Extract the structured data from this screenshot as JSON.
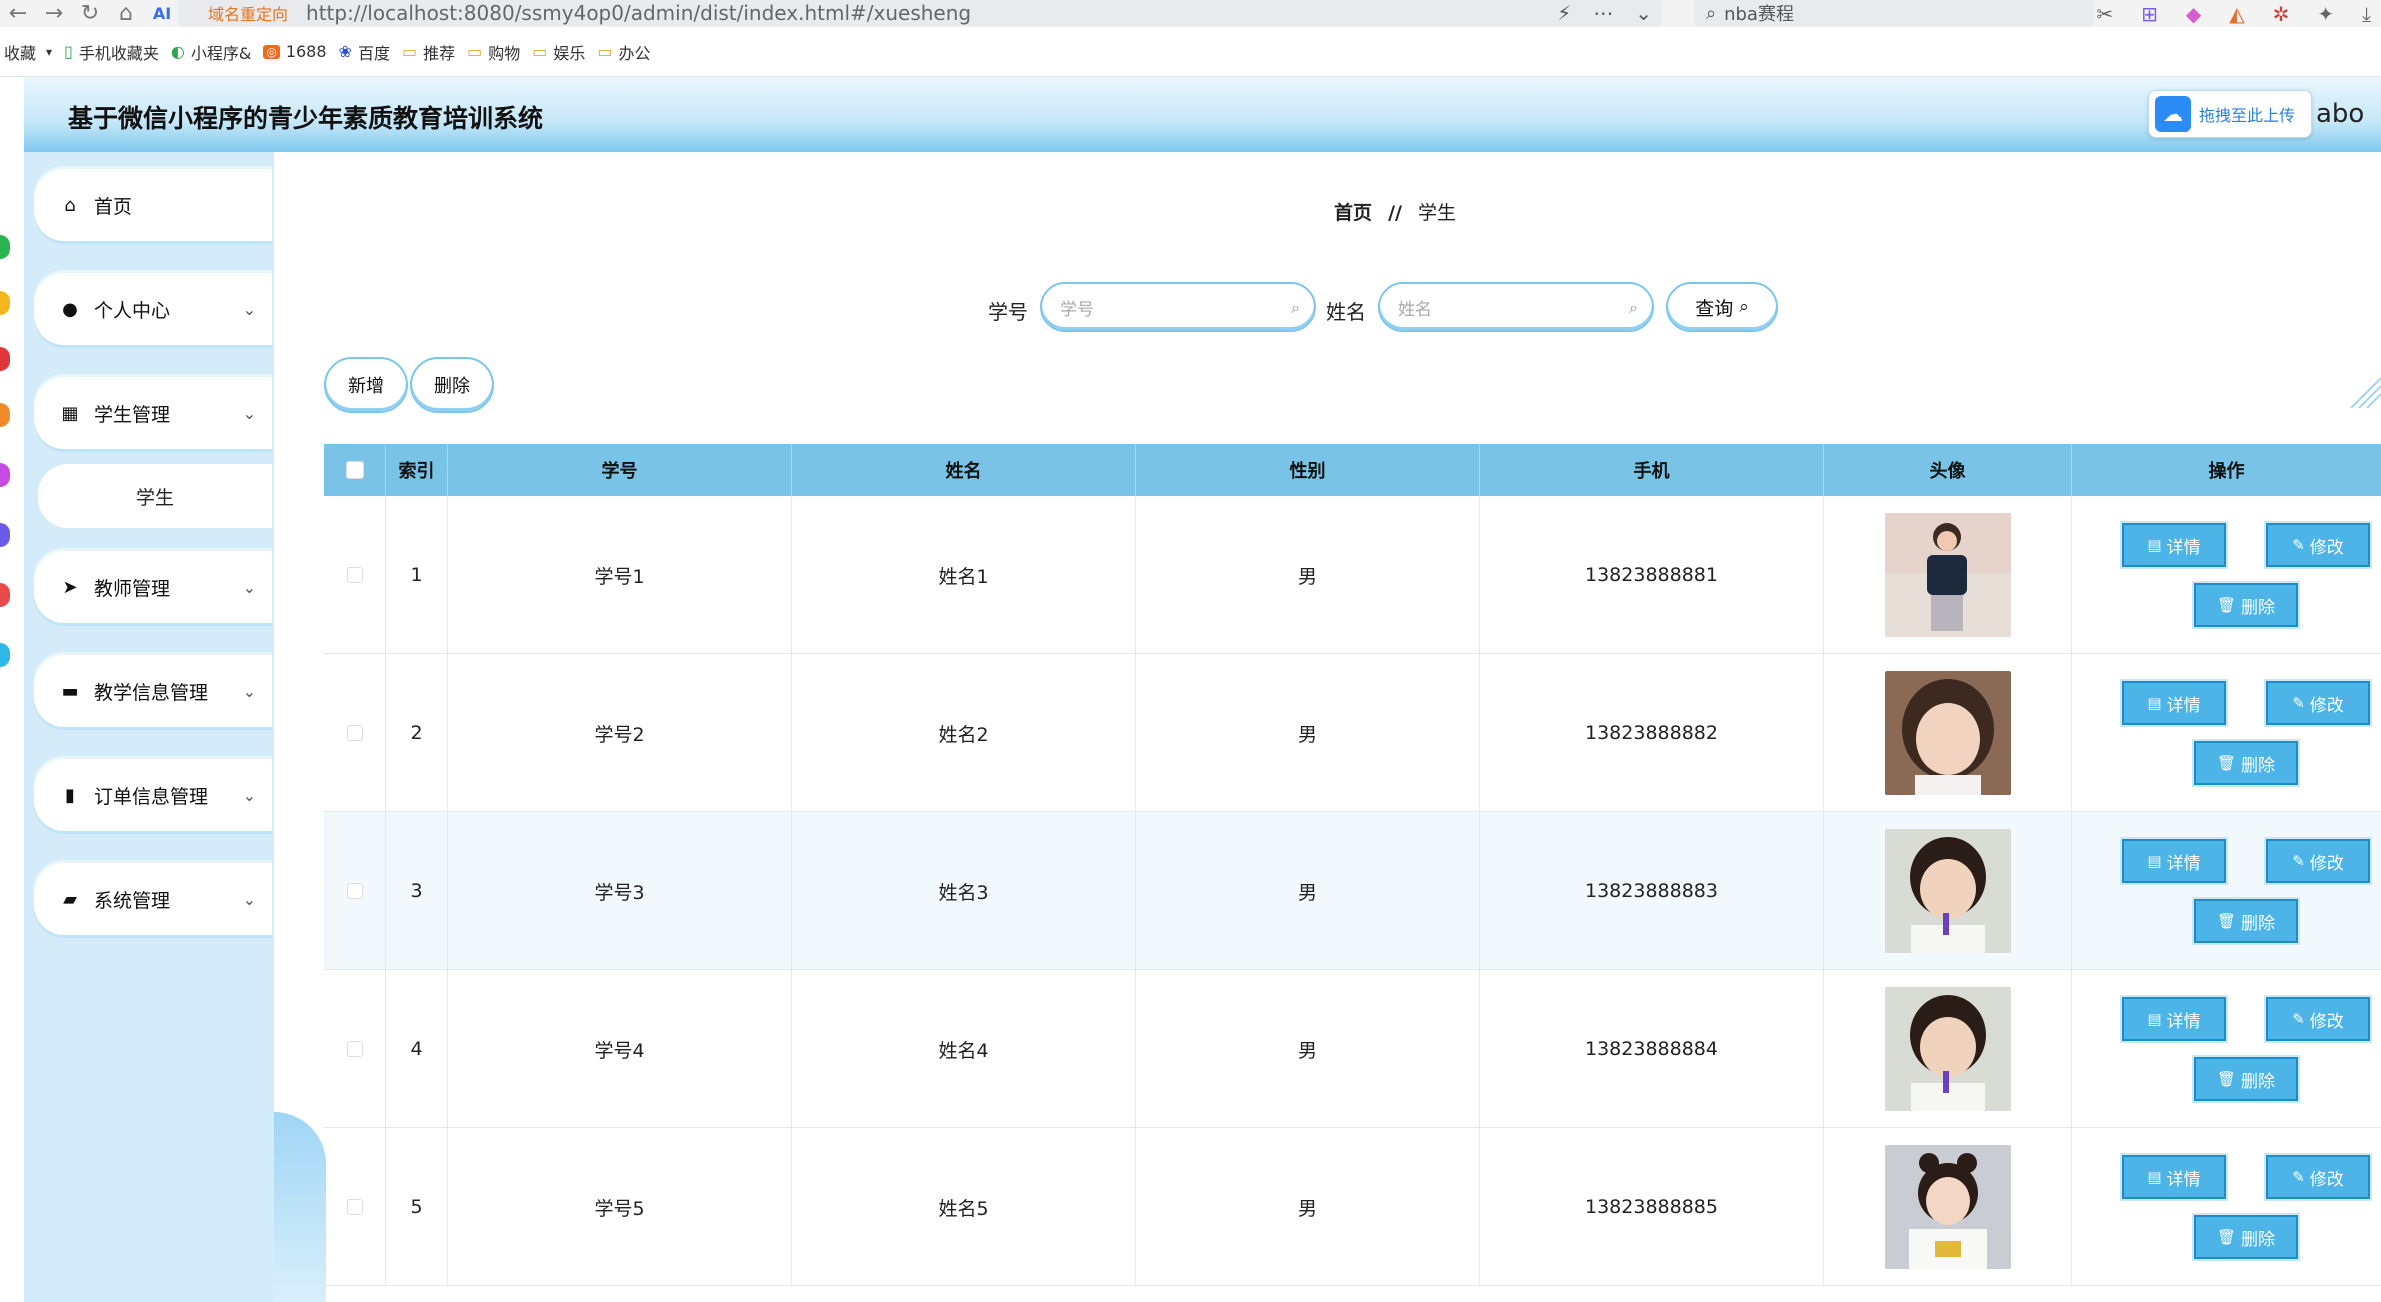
{
  "browser": {
    "redirect_chip": "域名重定向",
    "url": "http://localhost:8080/ssmy4op0/admin/dist/index.html#/xuesheng",
    "search_text": "nba赛程"
  },
  "bookmarks": [
    {
      "label": "收藏",
      "icon": "star-icon"
    },
    {
      "label": "手机收藏夹",
      "icon": "phone-icon"
    },
    {
      "label": "小程序&",
      "icon": "miniapp-icon"
    },
    {
      "label": "1688",
      "icon": "1688-icon"
    },
    {
      "label": "百度",
      "icon": "baidu-icon"
    },
    {
      "label": "推荐",
      "icon": "folder-icon"
    },
    {
      "label": "购物",
      "icon": "folder-icon"
    },
    {
      "label": "娱乐",
      "icon": "folder-icon"
    },
    {
      "label": "办公",
      "icon": "folder-icon"
    }
  ],
  "header": {
    "title": "基于微信小程序的青少年素质教育培训系统",
    "upload_label": "拖拽至此上传",
    "user": "abo"
  },
  "menu": {
    "items": [
      {
        "label": "首页",
        "icon": "home-icon"
      },
      {
        "label": "个人中心",
        "icon": "user-icon"
      },
      {
        "label": "学生管理",
        "icon": "grid-icon"
      },
      {
        "label": "教师管理",
        "icon": "send-icon"
      },
      {
        "label": "教学信息管理",
        "icon": "briefcase-icon"
      },
      {
        "label": "订单信息管理",
        "icon": "book-icon"
      },
      {
        "label": "系统管理",
        "icon": "camera-icon"
      }
    ],
    "sub_item": "学生"
  },
  "breadcrumb": {
    "home": "首页",
    "sep": "//",
    "current": "学生"
  },
  "search": {
    "id_label": "学号",
    "id_placeholder": "学号",
    "name_label": "姓名",
    "name_placeholder": "姓名",
    "query_label": "查询"
  },
  "actions": {
    "add": "新增",
    "delete": "删除"
  },
  "table": {
    "headers": [
      "索引",
      "学号",
      "姓名",
      "性别",
      "手机",
      "头像",
      "操作"
    ],
    "rows": [
      {
        "index": "1",
        "id": "学号1",
        "name": "姓名1",
        "gender": "男",
        "phone": "13823888881"
      },
      {
        "index": "2",
        "id": "学号2",
        "name": "姓名2",
        "gender": "男",
        "phone": "13823888882"
      },
      {
        "index": "3",
        "id": "学号3",
        "name": "姓名3",
        "gender": "男",
        "phone": "13823888883"
      },
      {
        "index": "4",
        "id": "学号4",
        "name": "姓名4",
        "gender": "男",
        "phone": "13823888884"
      },
      {
        "index": "5",
        "id": "学号5",
        "name": "姓名5",
        "gender": "男",
        "phone": "13823888885"
      }
    ],
    "ops": {
      "detail": "详情",
      "edit": "修改",
      "delete": "删除"
    }
  },
  "colors": {
    "accent": "#79c3e6",
    "button": "#4db4e8",
    "menu_bg": "#d4ecfa"
  }
}
